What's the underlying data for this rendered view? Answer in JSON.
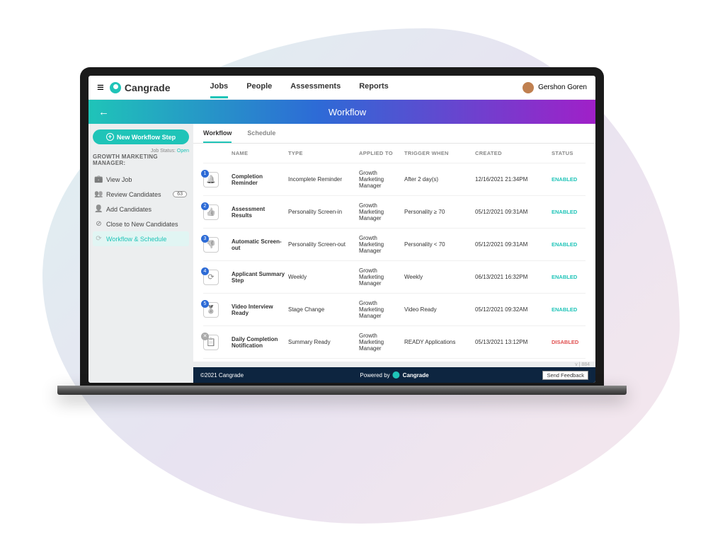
{
  "brand": "Cangrade",
  "nav": [
    {
      "label": "Jobs",
      "active": true
    },
    {
      "label": "People",
      "active": false
    },
    {
      "label": "Assessments",
      "active": false
    },
    {
      "label": "Reports",
      "active": false
    }
  ],
  "user_name": "Gershon Goren",
  "page_title": "Workflow",
  "sidebar": {
    "new_step_label": "New Workflow Step",
    "job_status_prefix": "Job Status: ",
    "job_status_value": "Open",
    "job_name": "GROWTH MARKETING MANAGER:",
    "items": [
      {
        "icon": "briefcase",
        "label": "View Job",
        "active": false,
        "badge": null
      },
      {
        "icon": "users",
        "label": "Review Candidates",
        "active": false,
        "badge": "63"
      },
      {
        "icon": "add-user",
        "label": "Add Candidates",
        "active": false,
        "badge": null
      },
      {
        "icon": "close-circle",
        "label": "Close to New Candidates",
        "active": false,
        "badge": null
      },
      {
        "icon": "clock",
        "label": "Workflow & Schedule",
        "active": true,
        "badge": null
      }
    ]
  },
  "subtabs": [
    {
      "label": "Workflow",
      "active": true
    },
    {
      "label": "Schedule",
      "active": false
    }
  ],
  "columns": [
    "",
    "NAME",
    "TYPE",
    "APPLIED TO",
    "TRIGGER WHEN",
    "CREATED",
    "STATUS"
  ],
  "rows": [
    {
      "num": "1",
      "icon": "bell",
      "name": "Completion Reminder",
      "type": "Incomplete Reminder",
      "applied": "Growth Marketing Manager",
      "trigger": "After 2 day(s)",
      "created": "12/16/2021 21:34PM",
      "status": "ENABLED",
      "enabled": true
    },
    {
      "num": "2",
      "icon": "thumbs-up",
      "name": "Assessment Results",
      "type": "Personality Screen-in",
      "applied": "Growth Marketing Manager",
      "trigger": "Personality ≥ 70",
      "created": "05/12/2021 09:31AM",
      "status": "ENABLED",
      "enabled": true
    },
    {
      "num": "3",
      "icon": "thumbs-down",
      "name": "Automatic Screen-out",
      "type": "Personality Screen-out",
      "applied": "Growth Marketing Manager",
      "trigger": "Personality < 70",
      "created": "05/12/2021 09:31AM",
      "status": "ENABLED",
      "enabled": true
    },
    {
      "num": "4",
      "icon": "clock",
      "name": "Applicant Summary Step",
      "type": "Weekly",
      "applied": "Growth Marketing Manager",
      "trigger": "Weekly",
      "created": "06/13/2021 16:32PM",
      "status": "ENABLED",
      "enabled": true
    },
    {
      "num": "5",
      "icon": "badge",
      "name": "Video Interview Ready",
      "type": "Stage Change",
      "applied": "Growth Marketing Manager",
      "trigger": "Video Ready",
      "created": "05/12/2021 09:32AM",
      "status": "ENABLED",
      "enabled": true
    },
    {
      "num": "✕",
      "icon": "clipboard",
      "name": "Daily Completion Notification",
      "type": "Summary Ready",
      "applied": "Growth Marketing Manager",
      "trigger": "READY Applications",
      "created": "05/13/2021 13:12PM",
      "status": "DISABLED",
      "enabled": false
    }
  ],
  "version": "v | 884",
  "footer": {
    "copyright": "©2021 Cangrade",
    "powered": "Powered by",
    "brand": "Cangrade",
    "feedback": "Send Feedback"
  },
  "icon_glyphs": {
    "briefcase": "💼",
    "users": "👥",
    "add-user": "👤",
    "close-circle": "⊘",
    "clock": "⟳",
    "bell": "🔔",
    "thumbs-up": "👍",
    "thumbs-down": "👎",
    "badge": "🏅",
    "clipboard": "📋"
  }
}
